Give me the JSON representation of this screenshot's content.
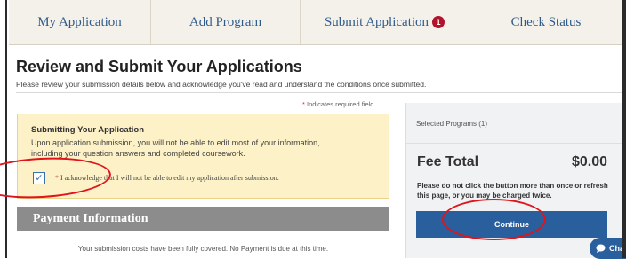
{
  "tabs": [
    {
      "label": "My Application"
    },
    {
      "label": "Add Program"
    },
    {
      "label": "Submit Application",
      "badge": "1"
    },
    {
      "label": "Check Status"
    }
  ],
  "page": {
    "title": "Review and Submit Your Applications",
    "subtitle": "Please review your submission details below and acknowledge you've read and understand the conditions once submitted."
  },
  "required_note": {
    "star": "*",
    "text": " Indicates required field"
  },
  "notice": {
    "title": "Submitting Your Application",
    "body": "Upon application submission, you will not be able to edit most of your information, including your question answers and completed coursework.",
    "checkbox_checked": true,
    "checkbox_mark": "✓",
    "ack_star": "*",
    "ack_text": " I acknowledge that I will not be able to edit my application after submission."
  },
  "payment": {
    "header": "Payment Information",
    "text": "Your submission costs have been fully covered. No Payment is due at this time."
  },
  "summary": {
    "selected_programs": "Selected Programs (1)",
    "fee_label": "Fee Total",
    "fee_value": "$0.00",
    "warning": "Please do not click the button more than once or refresh this page, or you may be charged twice.",
    "continue_label": "Continue"
  },
  "chat": {
    "label": "Cha",
    "icon": "chat-bubble-icon"
  },
  "colors": {
    "link": "#2f5b8b",
    "badge": "#b0132b",
    "notice_bg": "#fdf1c7",
    "button": "#2a5f9e",
    "annotation": "#e0141b",
    "payment_header": "#8c8c8c"
  }
}
